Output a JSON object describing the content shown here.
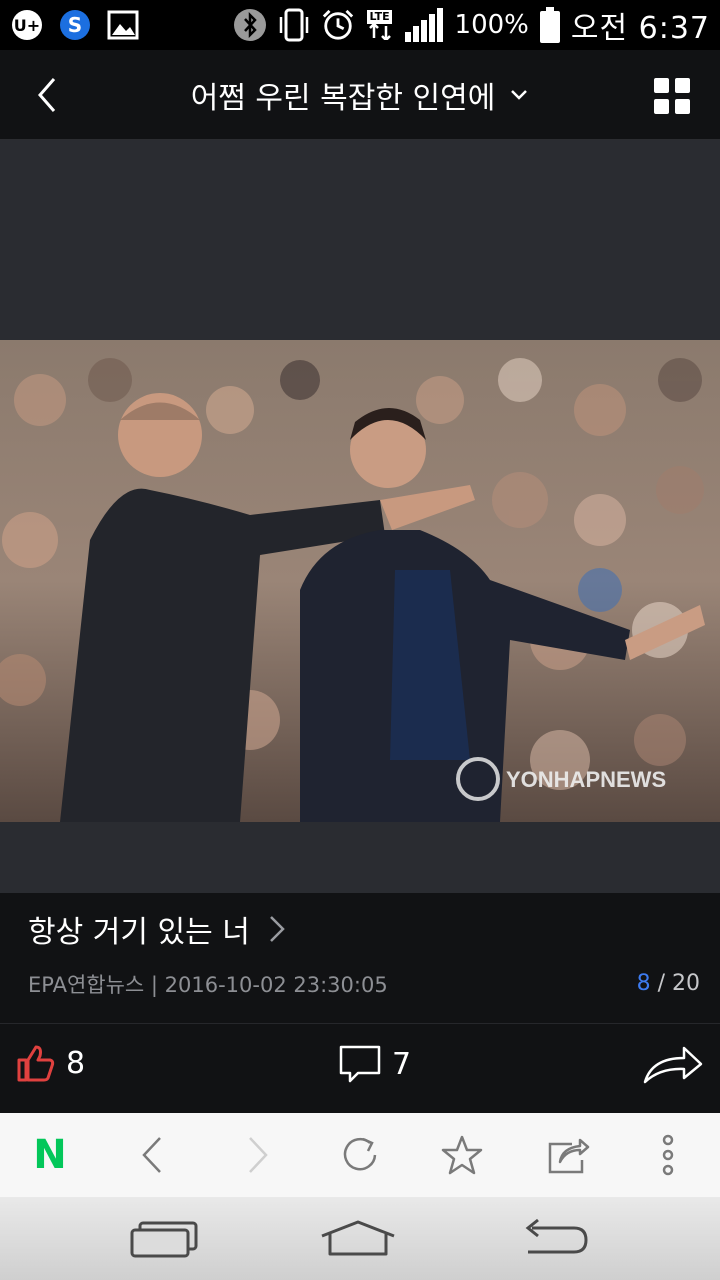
{
  "status_bar": {
    "battery": "100%",
    "network": "LTE",
    "time": "오전 6:37",
    "icons": [
      "u-plus-icon",
      "s-icon",
      "gallery-icon",
      "bluetooth-icon",
      "vibrate-icon",
      "alarm-icon",
      "lte-icon",
      "signal-icon",
      "battery-icon"
    ]
  },
  "header": {
    "title": "어쩜 우린 복잡한 인연에",
    "back_icon": "chevron-left-icon",
    "dropdown_icon": "chevron-down-icon",
    "grid_icon": "grid-icon"
  },
  "photo": {
    "watermark": "YONHAPNEWS"
  },
  "caption": {
    "title": "항상 거기 있는 너",
    "meta": "EPA연합뉴스 | 2016-10-02 23:30:05",
    "current": "8",
    "separator": " / ",
    "total": "20"
  },
  "actions": {
    "likes": "8",
    "comments": "7",
    "like_color": "#e0413f"
  },
  "browser": {
    "n_logo": "N",
    "n_color": "#03c75a"
  }
}
